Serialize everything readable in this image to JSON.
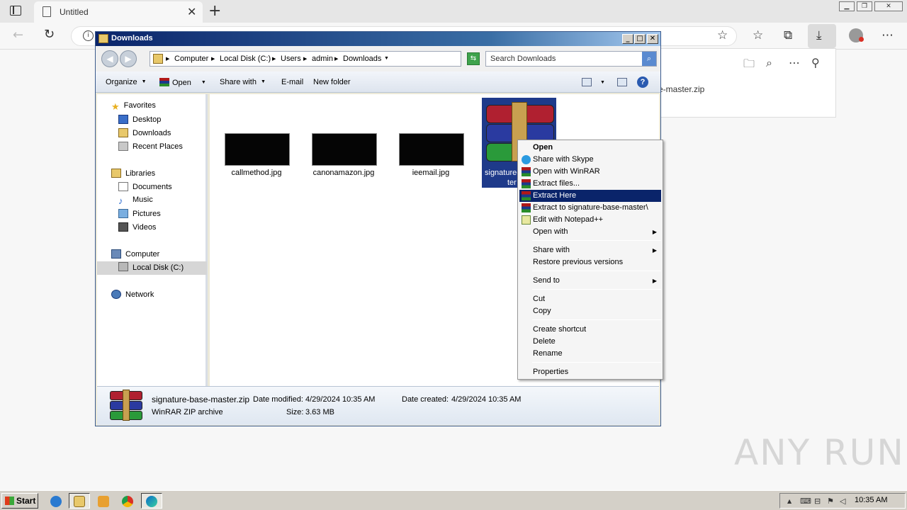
{
  "browser": {
    "tab_title": "Untitled",
    "downloads_panel": {
      "file_name_partial": "e-master.zip"
    }
  },
  "explorer": {
    "title": "Downloads",
    "breadcrumb": [
      "Computer",
      "Local Disk (C:)",
      "Users",
      "admin",
      "Downloads"
    ],
    "search_placeholder": "Search Downloads",
    "commands": {
      "organize": "Organize",
      "open": "Open",
      "share_with": "Share with",
      "email": "E-mail",
      "new_folder": "New folder"
    },
    "nav": {
      "favorites": "Favorites",
      "desktop": "Desktop",
      "downloads": "Downloads",
      "recent_places": "Recent Places",
      "libraries": "Libraries",
      "documents": "Documents",
      "music": "Music",
      "pictures": "Pictures",
      "videos": "Videos",
      "computer": "Computer",
      "local_disk": "Local Disk (C:)",
      "network": "Network"
    },
    "files": [
      {
        "name": "callmethod.jpg"
      },
      {
        "name": "canonamazon.jpg"
      },
      {
        "name": "ieemail.jpg"
      },
      {
        "name_line1": "signature-",
        "name_line2": "ter"
      }
    ],
    "status": {
      "file_name": "signature-base-master.zip",
      "date_modified_label": "Date modified:",
      "date_modified": "4/29/2024 10:35 AM",
      "date_created_label": "Date created:",
      "date_created": "4/29/2024 10:35 AM",
      "type": "WinRAR ZIP archive",
      "size_label": "Size:",
      "size": "3.63 MB"
    }
  },
  "context_menu": {
    "items": [
      "Open",
      "Share with Skype",
      "Open with WinRAR",
      "Extract files...",
      "Extract Here",
      "Extract to signature-base-master\\",
      "Edit with Notepad++",
      "Open with",
      "Share with",
      "Restore previous versions",
      "Send to",
      "Cut",
      "Copy",
      "Create shortcut",
      "Delete",
      "Rename",
      "Properties"
    ],
    "highlighted": "Extract Here"
  },
  "taskbar": {
    "start_label": "Start",
    "clock": "10:35 AM"
  },
  "watermark": "ANY RUN"
}
